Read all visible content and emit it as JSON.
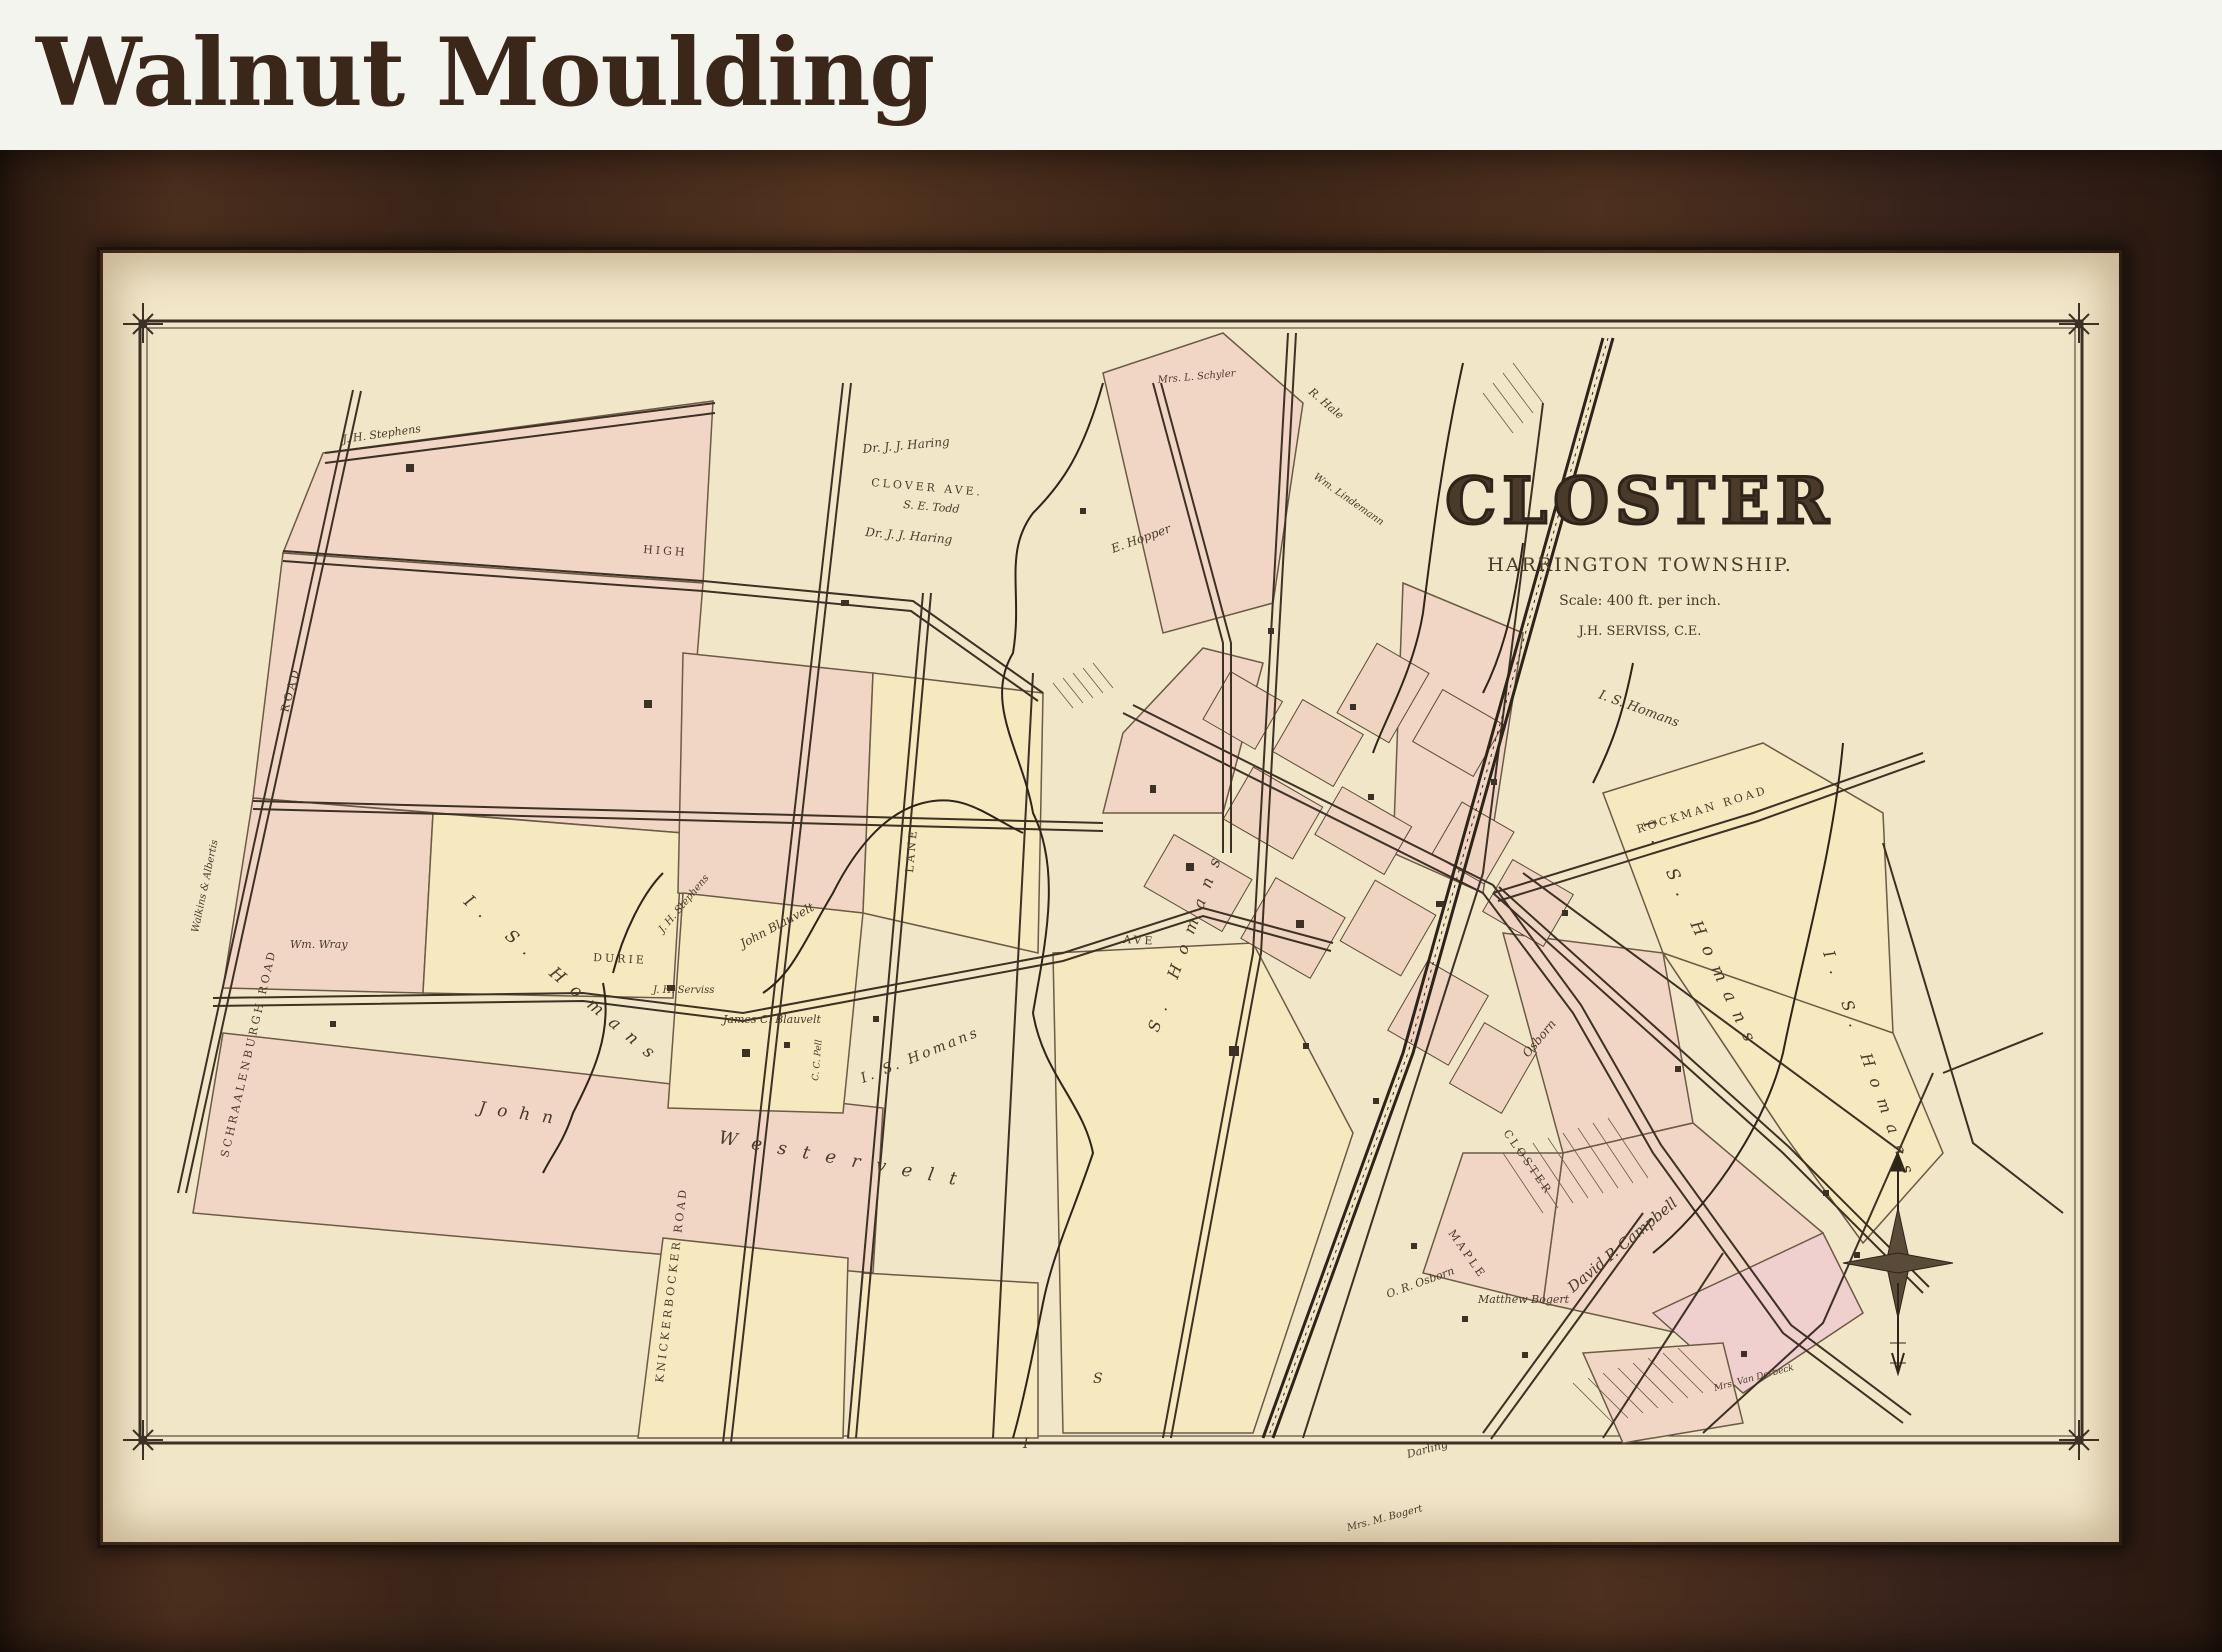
{
  "header": {
    "title": "Walnut Moulding"
  },
  "map": {
    "title": "CLOSTER",
    "subtitle": "HARRINGTON TOWNSHIP.",
    "scale": "Scale: 400 ft. per inch.",
    "author": "J.H. SERVISS, C.E.",
    "roads": [
      {
        "name": "CLOVER AVE."
      },
      {
        "name": "HIGH"
      },
      {
        "name": "DURIE"
      },
      {
        "name": "ROAD"
      },
      {
        "name": "KNICKERBOCKER ROAD"
      },
      {
        "name": "LANE"
      },
      {
        "name": "ROCKMAN ROAD"
      },
      {
        "name": "AVE"
      },
      {
        "name": "SCHRAALENBURGH ROAD"
      },
      {
        "name": "CLOSTER"
      },
      {
        "name": "MAPLE"
      }
    ],
    "owners": [
      {
        "name": "J. H. Stephens"
      },
      {
        "name": "Dr. J. J. Haring"
      },
      {
        "name": "S. E. Todd"
      },
      {
        "name": "Dr. J. J. Haring"
      },
      {
        "name": "Mrs. L. Schyler"
      },
      {
        "name": "R. Hale"
      },
      {
        "name": "E. Hopper"
      },
      {
        "name": "Wm. Lindemann"
      },
      {
        "name": "I. S. Homans"
      },
      {
        "name": "John Blauvelt"
      },
      {
        "name": "J. H. Stephens"
      },
      {
        "name": "Wm. Wray"
      },
      {
        "name": "I. S. Homans"
      },
      {
        "name": "J. H. Serviss"
      },
      {
        "name": "James C. Blauvelt"
      },
      {
        "name": "C. C. Pell"
      },
      {
        "name": "I. S. Homans"
      },
      {
        "name": "John"
      },
      {
        "name": "Westervelt"
      },
      {
        "name": "S. Homans"
      },
      {
        "name": "I. S. Homans"
      },
      {
        "name": "Osborn"
      },
      {
        "name": "O. R. Osborn"
      },
      {
        "name": "David P. Campbell"
      },
      {
        "name": "Matthew Bogert"
      },
      {
        "name": "Darling"
      },
      {
        "name": "Mrs. M. Bogert"
      },
      {
        "name": "Mrs. Van Derbeck"
      },
      {
        "name": "Walkins & Albertis"
      },
      {
        "name": "I. S. Homans"
      },
      {
        "name": "S"
      },
      {
        "name": "I"
      }
    ]
  },
  "colors": {
    "frame": "#3f2819",
    "paper": "#f4e9cc",
    "parcel_pink": "#f1d6c6",
    "parcel_yellow": "#f6e8bf",
    "ink": "#3d3024",
    "header_text": "#3b2719"
  }
}
